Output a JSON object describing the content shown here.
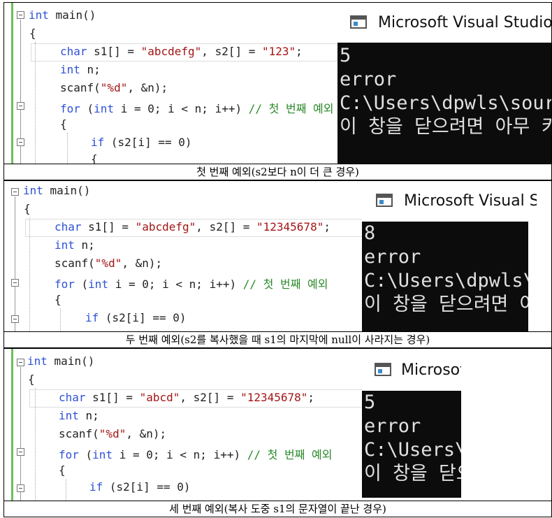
{
  "captions": [
    "첫 번째 예외(s2보다 n이 더 큰 경우)",
    "두 번째 예외(s2를 복사했을 때 s1의 마지막에 null이 사라지는 경우)",
    "세 번째 예외(복사 도중 s1의 문자열이 끝난 경우)"
  ],
  "console_title": "Microsoft Visual Studio Debug Console",
  "code": {
    "l1_type": "int",
    "l1_rest": " main()",
    "l2": "{",
    "l3_type": "char",
    "l4_type": "int",
    "l4_rest": " n;",
    "l5_pre": "scanf(",
    "l5_fmt": "\"%d\"",
    "l5_post": ", &n);",
    "l6_for": "for",
    "l6_a": " (",
    "l6_int": "int",
    "l6_b": " i = 0; i < n; i++) ",
    "l6_cmt": "// 첫 번째 예외",
    "l7": "{",
    "l8_if": "if",
    "l8_rest": " (s2[i] == 0)",
    "l9": "{"
  },
  "examples": [
    {
      "decl_a": " s1[] = ",
      "s1": "\"abcdefg\"",
      "decl_b": ", s2[] = ",
      "s2": "\"123\"",
      "decl_c": ";",
      "console": [
        "5",
        "error",
        "C:\\Users\\dpwls\\source",
        "이 창을 닫으려면 아무 키나 누르세요..."
      ]
    },
    {
      "decl_a": " s1[] = ",
      "s1": "\"abcdefg\"",
      "decl_b": ", s2[] = ",
      "s2": "\"12345678\"",
      "decl_c": ";",
      "console": [
        "8",
        "error",
        "C:\\Users\\dpwls\\source",
        "이 창을 닫으려면 아무 키나 누르세요..."
      ]
    },
    {
      "decl_a": " s1[] = ",
      "s1": "\"abcd\"",
      "decl_b": ", s2[] = ",
      "s2": "\"12345678\"",
      "decl_c": ";",
      "console": [
        "5",
        "error",
        "C:\\Users\\dpwls\\source",
        "이 창을 닫으려면 아무 키나 누르세요..."
      ]
    }
  ]
}
